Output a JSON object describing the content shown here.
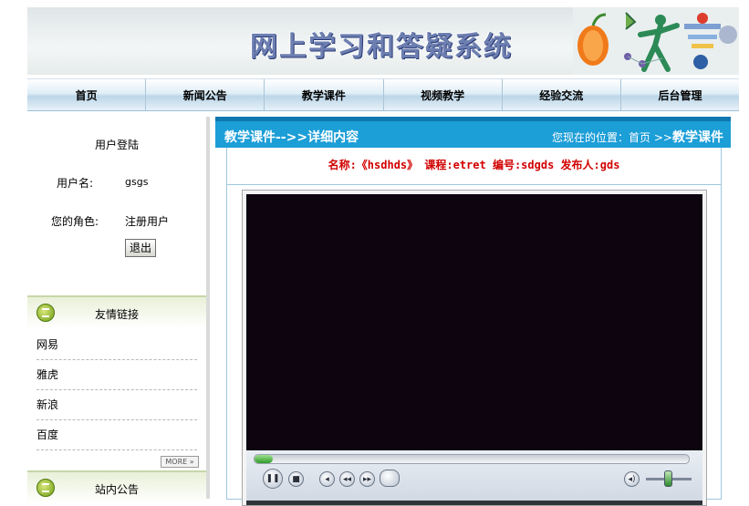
{
  "banner": {
    "title": "网上学习和答疑系统"
  },
  "nav": {
    "items": [
      "首页",
      "新闻公告",
      "教学课件",
      "视频教学",
      "经验交流",
      "后台管理"
    ]
  },
  "login": {
    "title": "用户登陆",
    "username_label": "用户名:",
    "username_value": "gsgs",
    "role_label": "您的角色:",
    "role_value": "注册用户",
    "logout_label": "退出"
  },
  "links": {
    "title": "友情链接",
    "items": [
      "网易",
      "雅虎",
      "新浪",
      "百度"
    ],
    "more_label": "MORE »"
  },
  "notice": {
    "title": "站内公告"
  },
  "content": {
    "title": "教学课件-->>详细内容",
    "location_prefix": "您现在的位置：",
    "location_home": "首页",
    "location_sep": " >>",
    "location_current": "教学课件",
    "detail": "名称:《hsdhds》 课程:etret 编号:sdgds 发布人:gds"
  },
  "player": {
    "progress_fraction": 0.04,
    "volume_fraction": 0.45,
    "buttons": [
      "pause-icon",
      "stop-icon",
      "prev-icon",
      "rewind-icon",
      "fast-forward-icon",
      "mouse-icon",
      "volume-icon"
    ]
  },
  "colors": {
    "header_blue": "#1c9ed7",
    "detail_red": "#d10000",
    "video_black": "#0d0410"
  }
}
